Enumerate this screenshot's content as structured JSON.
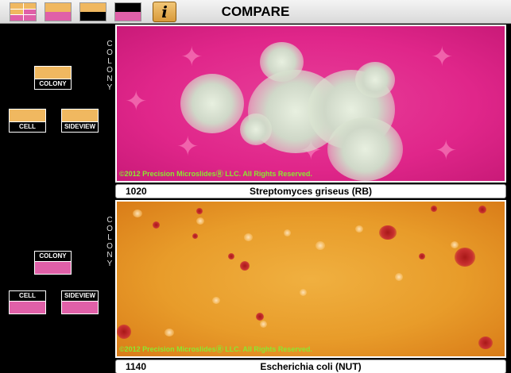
{
  "toolbar": {
    "title": "COMPARE",
    "info_glyph": "i",
    "buttons": [
      "grid-layout-icon",
      "split-orange-pink-icon",
      "split-orange-black-icon",
      "split-black-pink-icon",
      "info-icon"
    ]
  },
  "colors": {
    "orange": "#f0b860",
    "pink": "#e060a8",
    "black": "#000000",
    "white": "#ffffff",
    "copyright_green": "#8be830"
  },
  "panels": [
    {
      "view_label": [
        "C",
        "O",
        "L",
        "O",
        "N",
        "Y"
      ],
      "buttons": {
        "colony": "COLONY",
        "cell": "CELL",
        "sideview": "SIDEVIEW"
      },
      "copyright": "©2012 Precision MicroslidesⓇ LLC.  All Rights Reserved.",
      "number": "1020",
      "organism": "Streptomyces griseus (RB)"
    },
    {
      "view_label": [
        "C",
        "O",
        "L",
        "O",
        "N",
        "Y"
      ],
      "buttons": {
        "colony": "COLONY",
        "cell": "CELL",
        "sideview": "SIDEVIEW"
      },
      "copyright": "©2012 Precision MicroslidesⓇ LLC.  All Rights Reserved.",
      "number": "1140",
      "organism": "Escherichia coli (NUT)"
    }
  ]
}
